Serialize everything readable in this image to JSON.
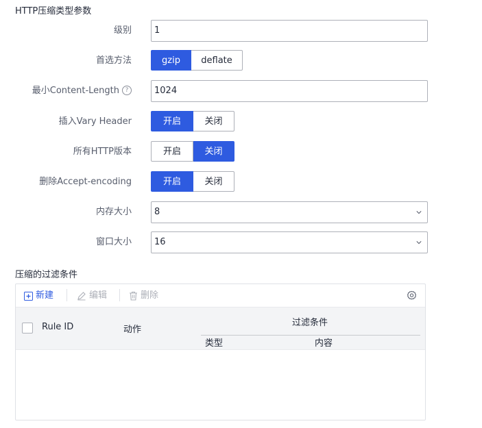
{
  "http_section": {
    "title": "HTTP压缩类型参数"
  },
  "form": {
    "level": {
      "label": "级别",
      "value": "1"
    },
    "preferred_method": {
      "label": "首选方法",
      "options": [
        "gzip",
        "deflate"
      ],
      "selected": "gzip"
    },
    "min_content_length": {
      "label": "最小Content-Length",
      "help": "?",
      "value": "1024"
    },
    "vary_header": {
      "label": "插入Vary Header",
      "options": [
        "开启",
        "关闭"
      ],
      "selected": "开启"
    },
    "all_http_versions": {
      "label": "所有HTTP版本",
      "options": [
        "开启",
        "关闭"
      ],
      "selected": "关闭"
    },
    "remove_accept_encoding": {
      "label": "删除Accept-encoding",
      "options": [
        "开启",
        "关闭"
      ],
      "selected": "开启"
    },
    "memory_size": {
      "label": "内存大小",
      "value": "8"
    },
    "window_size": {
      "label": "窗口大小",
      "value": "16"
    }
  },
  "filter_section": {
    "title": "压缩的过滤条件",
    "toolbar": {
      "new": "新建",
      "edit": "编辑",
      "delete": "删除"
    },
    "columns": {
      "rule_id": "Rule ID",
      "action": "动作",
      "filter_group": "过滤条件",
      "type": "类型",
      "content": "内容"
    },
    "rows": []
  },
  "colors": {
    "accent": "#2e5be0",
    "border": "#adb0b8",
    "label": "#575d6c",
    "disabled": "#adb0b8"
  }
}
